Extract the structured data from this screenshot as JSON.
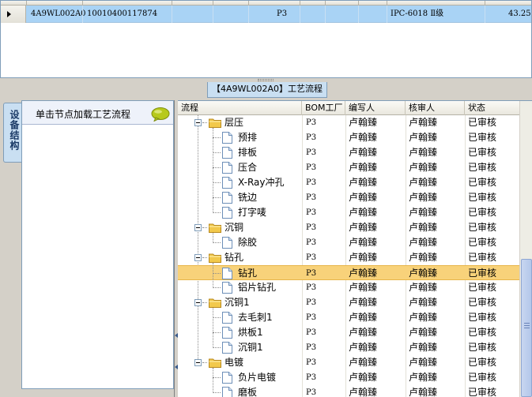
{
  "top_grid": {
    "row": {
      "code": "4A9WL002A0",
      "number": "10010400117874",
      "bom": "P3",
      "model": "IPC-6018 Ⅱ级",
      "value": "43.25"
    }
  },
  "section_title": "【4A9WL002A0】工艺流程",
  "left_tab_label": "设备结构",
  "hint_text": "单击节点加载工艺流程",
  "columns": [
    "流程",
    "BOM工厂",
    "编写人",
    "核审人",
    "状态"
  ],
  "rows": [
    {
      "name": "层压",
      "level": 0,
      "bom": "P3",
      "writer": "卢翰臻",
      "reviewer": "卢翰臻",
      "status": "已审核"
    },
    {
      "name": "预排",
      "level": 1,
      "bom": "P3",
      "writer": "卢翰臻",
      "reviewer": "卢翰臻",
      "status": "已审核"
    },
    {
      "name": "排板",
      "level": 1,
      "bom": "P3",
      "writer": "卢翰臻",
      "reviewer": "卢翰臻",
      "status": "已审核"
    },
    {
      "name": "压合",
      "level": 1,
      "bom": "P3",
      "writer": "卢翰臻",
      "reviewer": "卢翰臻",
      "status": "已审核"
    },
    {
      "name": "X-Ray冲孔",
      "level": 1,
      "bom": "P3",
      "writer": "卢翰臻",
      "reviewer": "卢翰臻",
      "status": "已审核"
    },
    {
      "name": "铣边",
      "level": 1,
      "bom": "P3",
      "writer": "卢翰臻",
      "reviewer": "卢翰臻",
      "status": "已审核"
    },
    {
      "name": "打字唛",
      "level": 1,
      "bom": "P3",
      "writer": "卢翰臻",
      "reviewer": "卢翰臻",
      "status": "已审核"
    },
    {
      "name": "沉铜",
      "level": 0,
      "bom": "P3",
      "writer": "卢翰臻",
      "reviewer": "卢翰臻",
      "status": "已审核"
    },
    {
      "name": "除胶",
      "level": 1,
      "bom": "P3",
      "writer": "卢翰臻",
      "reviewer": "卢翰臻",
      "status": "已审核"
    },
    {
      "name": "钻孔",
      "level": 0,
      "bom": "P3",
      "writer": "卢翰臻",
      "reviewer": "卢翰臻",
      "status": "已审核"
    },
    {
      "name": "钻孔",
      "level": 1,
      "bom": "P3",
      "writer": "卢翰臻",
      "reviewer": "卢翰臻",
      "status": "已审核",
      "selected": true
    },
    {
      "name": "铝片钻孔",
      "level": 1,
      "bom": "P3",
      "writer": "卢翰臻",
      "reviewer": "卢翰臻",
      "status": "已审核"
    },
    {
      "name": "沉铜1",
      "level": 0,
      "bom": "P3",
      "writer": "卢翰臻",
      "reviewer": "卢翰臻",
      "status": "已审核"
    },
    {
      "name": "去毛刺1",
      "level": 1,
      "bom": "P3",
      "writer": "卢翰臻",
      "reviewer": "卢翰臻",
      "status": "已审核"
    },
    {
      "name": "烘板1",
      "level": 1,
      "bom": "P3",
      "writer": "卢翰臻",
      "reviewer": "卢翰臻",
      "status": "已审核"
    },
    {
      "name": "沉铜1",
      "level": 1,
      "bom": "P3",
      "writer": "卢翰臻",
      "reviewer": "卢翰臻",
      "status": "已审核"
    },
    {
      "name": "电镀",
      "level": 0,
      "bom": "P3",
      "writer": "卢翰臻",
      "reviewer": "卢翰臻",
      "status": "已审核"
    },
    {
      "name": "负片电镀",
      "level": 1,
      "bom": "P3",
      "writer": "卢翰臻",
      "reviewer": "卢翰臻",
      "status": "已审核"
    },
    {
      "name": "磨板",
      "level": 1,
      "bom": "P3",
      "writer": "卢翰臻",
      "reviewer": "卢翰臻",
      "status": "已审核"
    }
  ]
}
